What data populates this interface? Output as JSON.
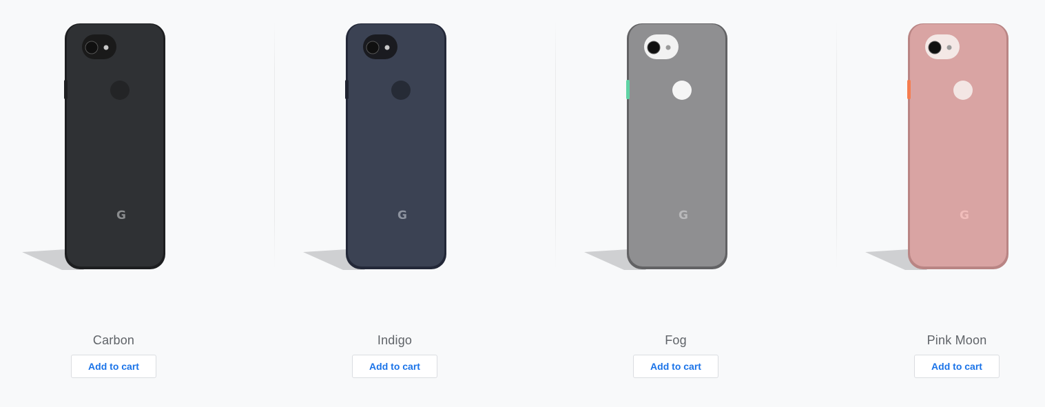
{
  "products": [
    {
      "name": "Carbon",
      "cart_label": "Add to cart",
      "colors": {
        "case": "#2f3134",
        "case_edge": "#1d1e20",
        "camera": "#1a1a1a",
        "sensor": "#232426",
        "g": "#8a8c8e",
        "button": "#1f2022"
      }
    },
    {
      "name": "Indigo",
      "cart_label": "Add to cart",
      "colors": {
        "case": "#3b4253",
        "case_edge": "#232838",
        "camera": "#1a1b20",
        "sensor": "#262b36",
        "g": "#8d939f",
        "button": "#1f2330"
      }
    },
    {
      "name": "Fog",
      "cart_label": "Add to cart",
      "colors": {
        "case": "#8f8f91",
        "case_edge": "#626264",
        "camera": "#f2f2f2",
        "sensor": "#f5f5f5",
        "g": "#b9b9bb",
        "button": "#5fd3a4"
      }
    },
    {
      "name": "Pink Moon",
      "cart_label": "Add to cart",
      "colors": {
        "case": "#d9a4a3",
        "case_edge": "#b98584",
        "camera": "#f4e8e6",
        "sensor": "#f3e6e4",
        "g": "#f1bdbb",
        "button": "#f57d4f"
      }
    }
  ]
}
